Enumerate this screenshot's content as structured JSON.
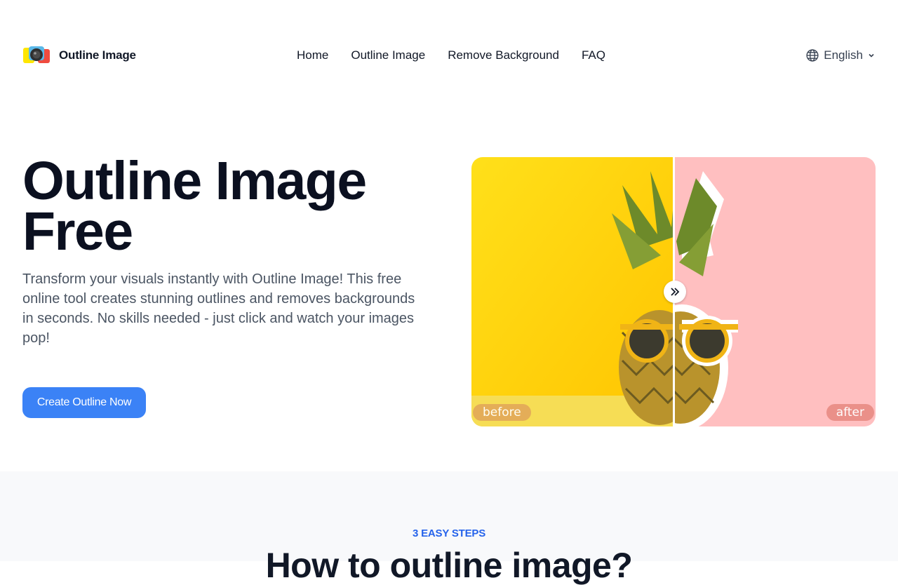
{
  "header": {
    "brand": "Outline Image",
    "nav": [
      "Home",
      "Outline Image",
      "Remove Background",
      "FAQ"
    ],
    "language": "English"
  },
  "hero": {
    "title_line1": "Outline Image",
    "title_line2": "Free",
    "description": "Transform your visuals instantly with Outline Image! This free online tool creates stunning outlines and removes backgrounds in seconds. No skills needed - just click and watch your images pop!",
    "cta_label": "Create Outline Now"
  },
  "compare": {
    "before_label": "before",
    "after_label": "after",
    "before_bg": "#ffd60a",
    "after_bg": "#ffbfc0",
    "slider_position": 0.5
  },
  "steps": {
    "kicker": "3 EASY STEPS",
    "title": "How to outline image?"
  },
  "icons": {
    "logo": "camera-logo-icon",
    "language": "globe-icon",
    "dropdown": "chevron-down-icon",
    "slider": "double-chevron-right-icon"
  },
  "colors": {
    "primary": "#3b82f6",
    "accent_text": "#2563eb",
    "section_bg": "#f8f9fb"
  }
}
